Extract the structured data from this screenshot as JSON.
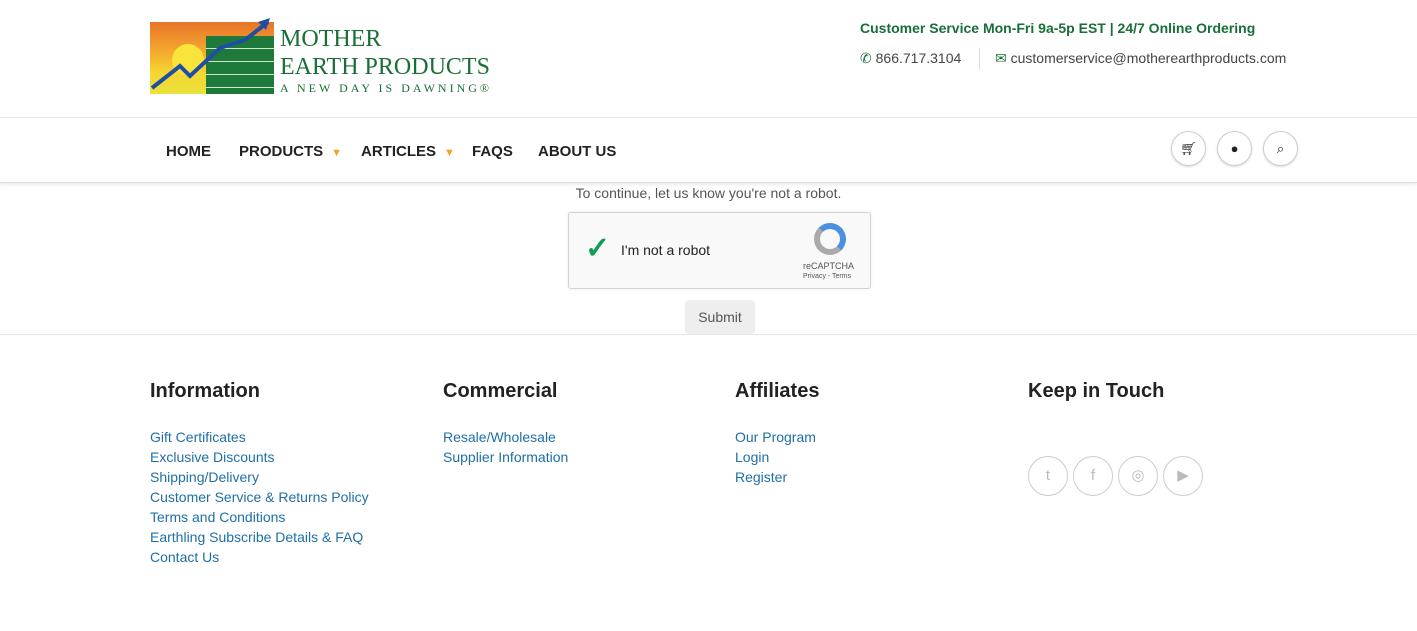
{
  "logo": {
    "line1": "MOTHER",
    "line2": "EARTH PRODUCTS",
    "tagline": "A NEW DAY IS DAWNING®"
  },
  "header": {
    "service": "Customer Service Mon-Fri 9a-5p EST | 24/7 Online Ordering",
    "phone": "866.717.3104",
    "email": "customerservice@motherearthproducts.com"
  },
  "nav": {
    "items": [
      "HOME",
      "PRODUCTS",
      "ARTICLES",
      "FAQS",
      "ABOUT US"
    ]
  },
  "captcha": {
    "prompt": "To continue, let us know you're not a robot.",
    "label": "I'm not a robot",
    "brand": "reCAPTCHA",
    "links": "Privacy - Terms",
    "submit": "Submit",
    "checked": true
  },
  "footer": {
    "information": {
      "title": "Information",
      "links": [
        "Gift Certificates",
        "Exclusive Discounts",
        "Shipping/Delivery",
        "Customer Service & Returns Policy",
        "Terms and Conditions",
        "Earthling Subscribe Details & FAQ",
        "Contact Us"
      ]
    },
    "commercial": {
      "title": "Commercial",
      "links": [
        "Resale/Wholesale",
        "Supplier Information"
      ]
    },
    "affiliates": {
      "title": "Affiliates",
      "links": [
        "Our Program",
        "Login",
        "Register"
      ]
    },
    "keep": {
      "title": "Keep in Touch",
      "social": [
        "twitter-icon",
        "facebook-icon",
        "instagram-icon",
        "youtube-icon"
      ]
    }
  }
}
